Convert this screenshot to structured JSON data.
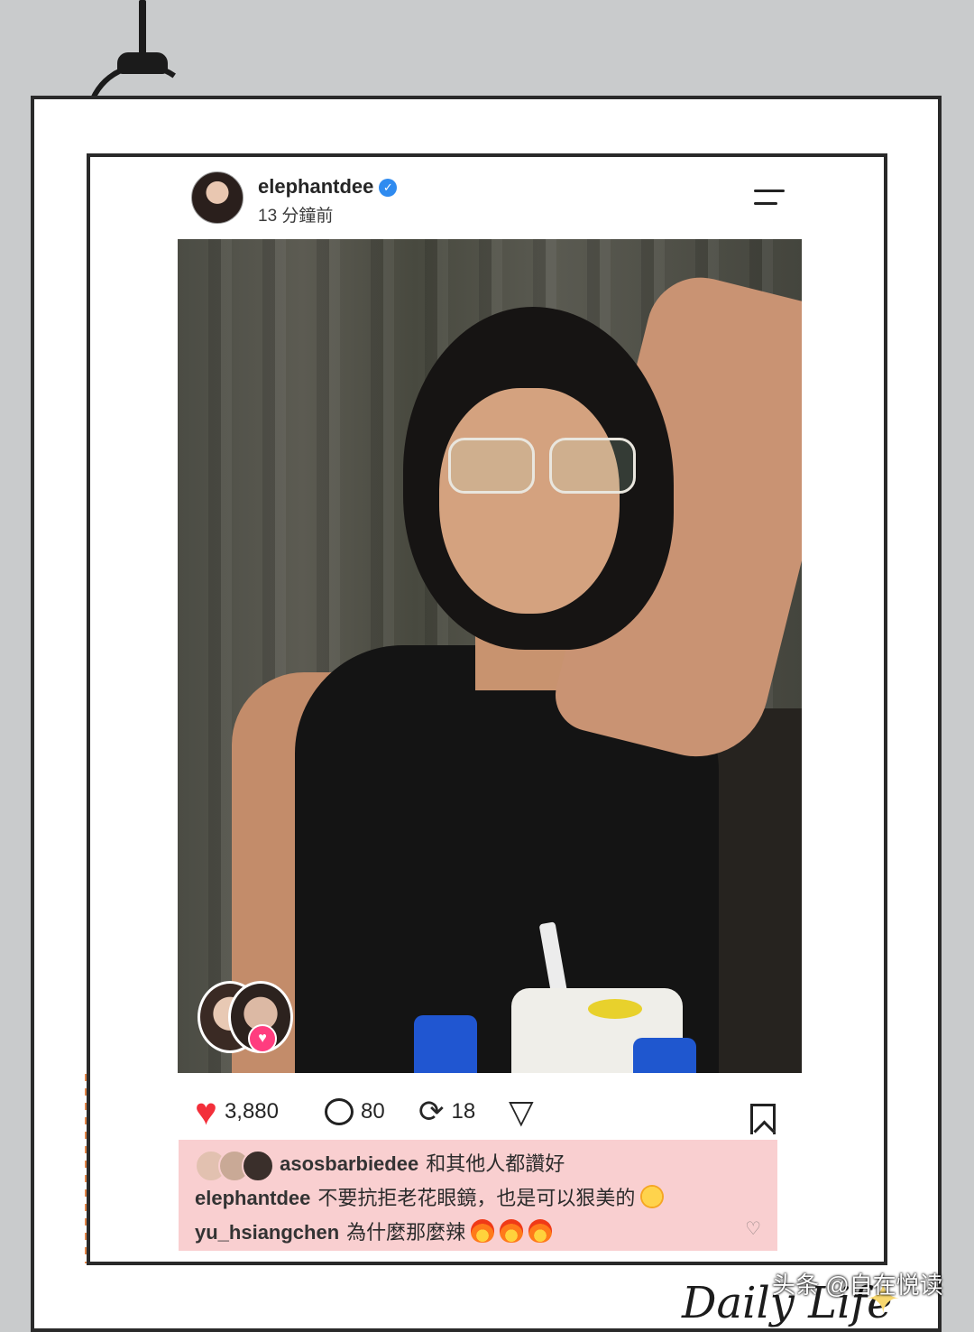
{
  "post": {
    "username": "elephantdee",
    "timestamp": "13 分鐘前",
    "verified_icon": "verified-badge-icon",
    "menu_icon": "menu-icon"
  },
  "actions": {
    "likes": "3,880",
    "comments": "80",
    "reposts": "18"
  },
  "likes_row": {
    "user": "asosbarbiedee",
    "text": "和其他人都讚好"
  },
  "comments": [
    {
      "user": "elephantdee",
      "text": "不要抗拒老花眼鏡，也是可以狠美的"
    },
    {
      "user": "yu_hsiangchen",
      "text": "為什麼那麼辣"
    }
  ],
  "overlay": {
    "watermark": "头条 @自在悦读",
    "script_text": "Daily Life"
  },
  "colors": {
    "heart": "#f32f3a",
    "verified": "#2f8bf0",
    "comment_panel": "#f9cfd0"
  }
}
